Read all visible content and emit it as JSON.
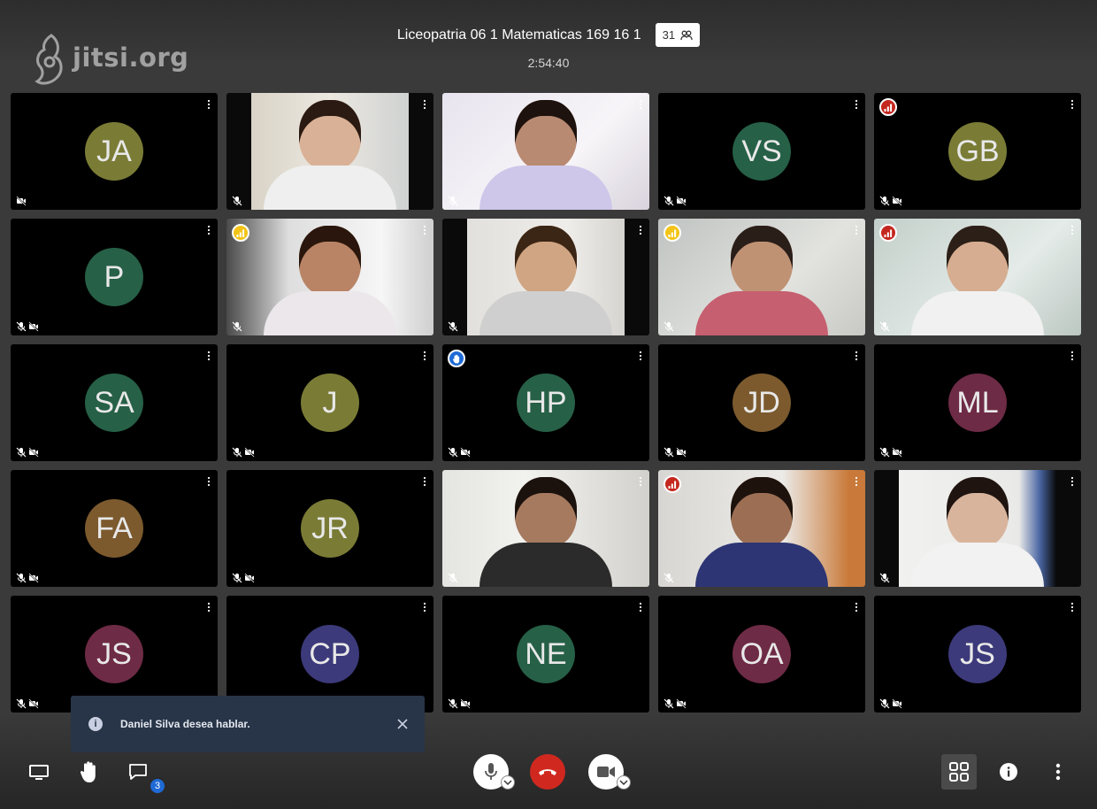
{
  "logo": {
    "text": "jitsi.org"
  },
  "header": {
    "title": "Liceopatria 06 1 Matematicas 169 16 1",
    "participant_count": "31",
    "timer": "2:54:40"
  },
  "tiles": [
    {
      "initials": "JA",
      "color": "#7a7c36",
      "video": false,
      "mic_muted": false,
      "cam_off": true
    },
    {
      "initials": "",
      "video": true,
      "scene": "girl-headphones",
      "mic_muted": true
    },
    {
      "initials": "",
      "video": true,
      "scene": "girl-pink-bow",
      "mic_muted": true
    },
    {
      "initials": "VS",
      "color": "#266047",
      "video": false,
      "mic_muted": true,
      "cam_off": true
    },
    {
      "initials": "GB",
      "color": "#7a7c36",
      "video": false,
      "mic_muted": true,
      "cam_off": true,
      "indicator": "poor"
    },
    {
      "initials": "P",
      "color": "#266047",
      "video": false,
      "mic_muted": true,
      "cam_off": true
    },
    {
      "initials": "",
      "video": true,
      "scene": "girl-window",
      "mic_muted": true,
      "indicator": "fair"
    },
    {
      "initials": "",
      "video": true,
      "scene": "girl-white-wall",
      "mic_muted": true
    },
    {
      "initials": "",
      "video": true,
      "scene": "girl-hand-chin",
      "mic_muted": true,
      "indicator": "fair"
    },
    {
      "initials": "",
      "video": true,
      "scene": "boy-tank-top",
      "mic_muted": true,
      "indicator": "poor"
    },
    {
      "initials": "SA",
      "color": "#266047",
      "video": false,
      "mic_muted": true,
      "cam_off": true
    },
    {
      "initials": "J",
      "color": "#7a7c36",
      "video": false,
      "mic_muted": true,
      "cam_off": true
    },
    {
      "initials": "HP",
      "color": "#266047",
      "video": false,
      "mic_muted": true,
      "cam_off": true,
      "indicator": "raised-hand"
    },
    {
      "initials": "JD",
      "color": "#7c5a2e",
      "video": false,
      "mic_muted": true,
      "cam_off": true
    },
    {
      "initials": "ML",
      "color": "#6e2b45",
      "video": false,
      "mic_muted": true,
      "cam_off": true
    },
    {
      "initials": "FA",
      "color": "#7c5a2e",
      "video": false,
      "mic_muted": true,
      "cam_off": true
    },
    {
      "initials": "JR",
      "color": "#7a7c36",
      "video": false,
      "mic_muted": true,
      "cam_off": true
    },
    {
      "initials": "",
      "video": true,
      "scene": "boy-smiling",
      "mic_muted": true
    },
    {
      "initials": "",
      "video": true,
      "scene": "girl-desk",
      "mic_muted": true,
      "indicator": "poor"
    },
    {
      "initials": "",
      "video": true,
      "scene": "boy-glasses",
      "mic_muted": true
    },
    {
      "initials": "JS",
      "color": "#6e2b45",
      "video": false,
      "mic_muted": true,
      "cam_off": true
    },
    {
      "initials": "CP",
      "color": "#3c3a7a",
      "video": false,
      "mic_muted": true,
      "cam_off": true
    },
    {
      "initials": "NE",
      "color": "#266047",
      "video": false,
      "mic_muted": true,
      "cam_off": true
    },
    {
      "initials": "OA",
      "color": "#6e2b45",
      "video": false,
      "mic_muted": true,
      "cam_off": true
    },
    {
      "initials": "JS",
      "color": "#3c3a7a",
      "video": false,
      "mic_muted": true,
      "cam_off": true
    }
  ],
  "notification": {
    "text": "Daniel Silva desea hablar.",
    "icon": "info-icon"
  },
  "toolbar": {
    "left": [
      "screen-share-icon",
      "raise-hand-icon",
      "chat-icon"
    ],
    "chat_unread": "3",
    "center": [
      "microphone-icon",
      "hangup-icon",
      "camera-icon"
    ],
    "right": [
      "tile-view-icon",
      "info-icon",
      "more-icon"
    ]
  },
  "colors": {
    "hangup": "#d0281f",
    "poor": "#c4271e",
    "fair": "#f3c417",
    "hand": "#1f6ad6",
    "toast": "#283548"
  }
}
